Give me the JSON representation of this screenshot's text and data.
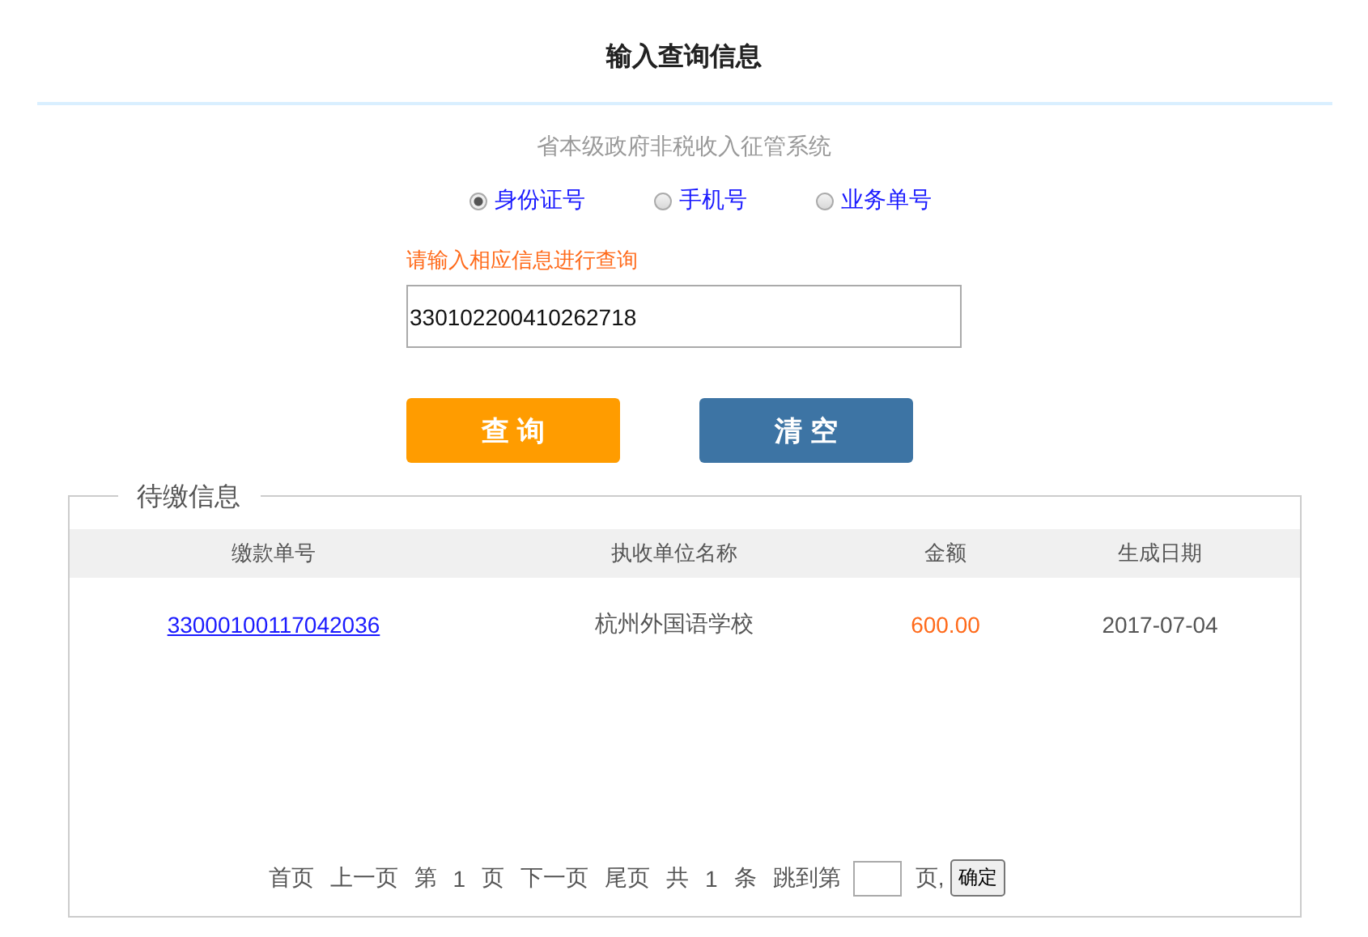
{
  "title": "输入查询信息",
  "subtitle": "省本级政府非税收入征管系统",
  "query_types": [
    {
      "label": "身份证号",
      "selected": true
    },
    {
      "label": "手机号",
      "selected": false
    },
    {
      "label": "业务单号",
      "selected": false
    }
  ],
  "hint": "请输入相应信息进行查询",
  "query_field": {
    "value": "330102200410262718"
  },
  "buttons": [
    {
      "label": "查 询",
      "kind": "primary"
    },
    {
      "label": "清 空",
      "kind": "secondary"
    }
  ],
  "pending": {
    "legend": "待缴信息",
    "columns": [
      "缴款单号",
      "执收单位名称",
      "金额",
      "生成日期"
    ],
    "rows": [
      [
        "33000100117042036",
        "杭州外国语学校",
        "600.00",
        "2017-07-04"
      ]
    ]
  },
  "pager": [
    {
      "kind": "link",
      "text": "首页"
    },
    {
      "kind": "link",
      "text": "上一页"
    },
    {
      "kind": "text",
      "text": "第"
    },
    {
      "kind": "text",
      "text": "1"
    },
    {
      "kind": "text",
      "text": "页"
    },
    {
      "kind": "link",
      "text": "下一页"
    },
    {
      "kind": "link",
      "text": "尾页"
    },
    {
      "kind": "text",
      "text": "共"
    },
    {
      "kind": "text",
      "text": "1"
    },
    {
      "kind": "text",
      "text": "条"
    },
    {
      "kind": "text",
      "text": "跳到第"
    },
    {
      "kind": "input"
    },
    {
      "kind": "text",
      "text": "页,"
    },
    {
      "kind": "button",
      "text": "确定"
    }
  ]
}
